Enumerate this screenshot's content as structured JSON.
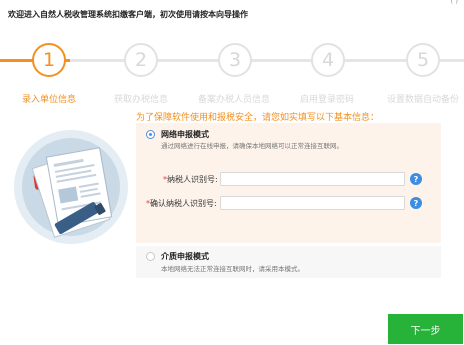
{
  "header": {
    "welcome_text": "欢迎进入自然人税收管理系统扣缴客户端，初次使用请按本向导操作",
    "corner_mark": "(    )"
  },
  "wizard": {
    "steps": [
      {
        "number": "1",
        "label": "录入单位信息",
        "active": true
      },
      {
        "number": "2",
        "label": "获取办税信息",
        "active": false
      },
      {
        "number": "3",
        "label": "备案办税人员信息",
        "active": false
      },
      {
        "number": "4",
        "label": "启用登录密码",
        "active": false
      },
      {
        "number": "5",
        "label": "设置数据自动备份",
        "active": false
      }
    ]
  },
  "notice": "为了保障软件使用和报税安全，请您如实填写以下基本信息：",
  "online_mode": {
    "title": "网络申报模式",
    "description": "通过网络进行在线申报，请确保本地网络可以正常连接互联网。",
    "selected": true,
    "fields": {
      "taxpayer_id_label": "纳税人识别号:",
      "taxpayer_id_value": "",
      "confirm_id_label": "确认纳税人识别号:",
      "confirm_id_value": "",
      "required_mark": "*",
      "help_glyph": "?"
    }
  },
  "offline_mode": {
    "title": "介质申报模式",
    "description": "本地网络无法正常连接互联网时，请采用本模式。",
    "selected": false
  },
  "buttons": {
    "next_label": "下一步"
  },
  "colors": {
    "accent": "#f29021",
    "primary_button": "#27b23a",
    "help_icon": "#3b8ee6"
  }
}
